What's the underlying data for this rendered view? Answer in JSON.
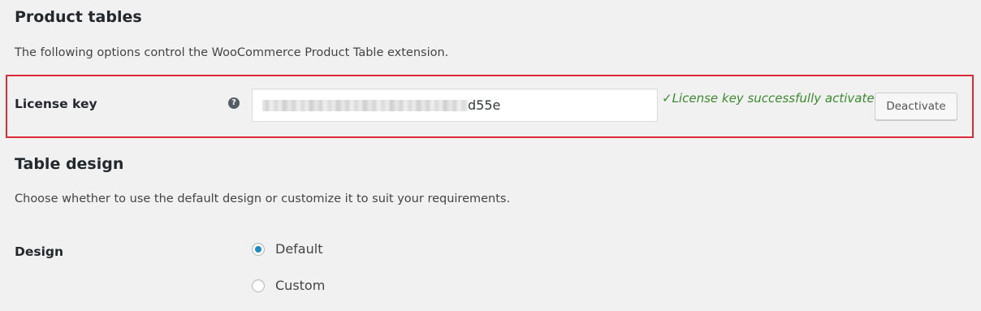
{
  "product_tables": {
    "title": "Product tables",
    "description": "The following options control the WooCommerce Product Table extension."
  },
  "license": {
    "label": "License key",
    "help_icon": "question-mark-icon",
    "key_visible_suffix": "d55e",
    "status_icon": "checkmark",
    "status_message": "✓License key successfully activated.",
    "deactivate_label": "Deactivate",
    "status_color": "#3b8a2e",
    "highlight_color": "#dd2c39"
  },
  "table_design": {
    "title": "Table design",
    "description": "Choose whether to use the default design or customize it to suit your requirements.",
    "design_label": "Design",
    "options": [
      {
        "label": "Default",
        "selected": true
      },
      {
        "label": "Custom",
        "selected": false
      }
    ],
    "radio_accent": "#1e8cbe"
  }
}
